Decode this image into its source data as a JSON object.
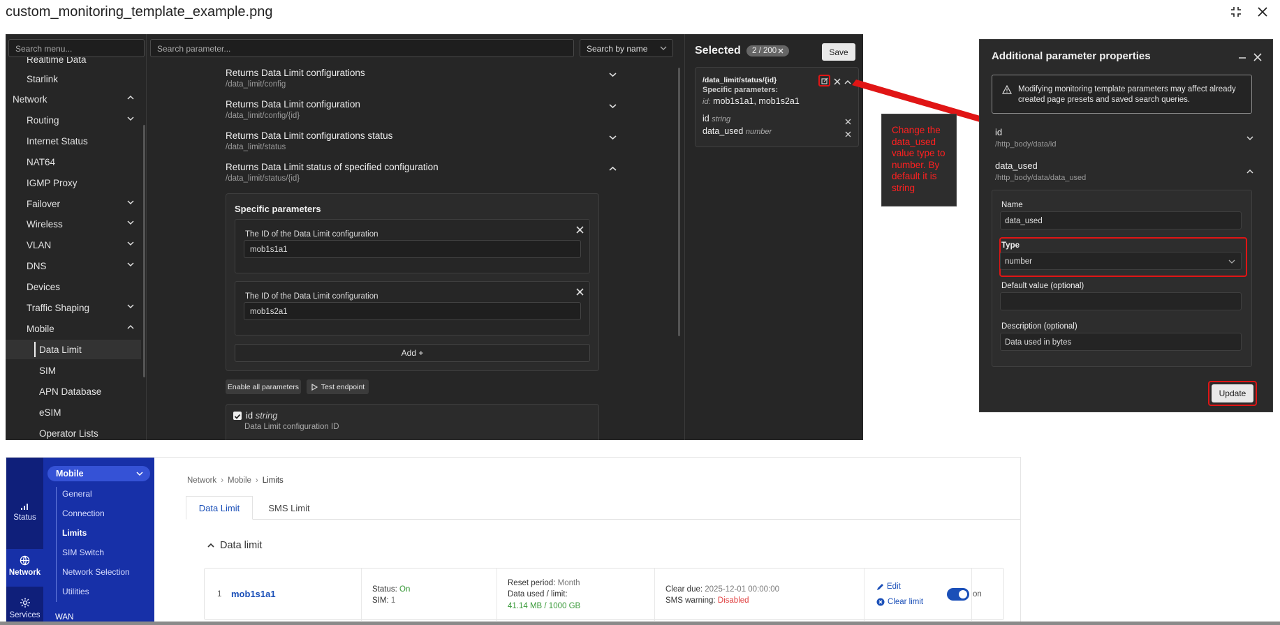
{
  "viewer": {
    "filename": "custom_monitoring_template_example.png"
  },
  "menu": {
    "search_placeholder": "Search menu...",
    "items": [
      {
        "label": "Realtime Data",
        "level": 1,
        "chevron": ""
      },
      {
        "label": "Starlink",
        "level": 1,
        "chevron": ""
      },
      {
        "label": "Network",
        "level": 0,
        "chevron": "up"
      },
      {
        "label": "Routing",
        "level": 1,
        "chevron": "down"
      },
      {
        "label": "Internet Status",
        "level": 1,
        "chevron": ""
      },
      {
        "label": "NAT64",
        "level": 1,
        "chevron": ""
      },
      {
        "label": "IGMP Proxy",
        "level": 1,
        "chevron": ""
      },
      {
        "label": "Failover",
        "level": 1,
        "chevron": "down"
      },
      {
        "label": "Wireless",
        "level": 1,
        "chevron": "down"
      },
      {
        "label": "VLAN",
        "level": 1,
        "chevron": "down"
      },
      {
        "label": "DNS",
        "level": 1,
        "chevron": "down"
      },
      {
        "label": "Devices",
        "level": 1,
        "chevron": ""
      },
      {
        "label": "Traffic Shaping",
        "level": 1,
        "chevron": "down"
      },
      {
        "label": "Mobile",
        "level": 1,
        "chevron": "up"
      },
      {
        "label": "Data Limit",
        "level": 2,
        "chevron": "",
        "active": true
      },
      {
        "label": "SIM",
        "level": 2,
        "chevron": ""
      },
      {
        "label": "APN Database",
        "level": 2,
        "chevron": ""
      },
      {
        "label": "eSIM",
        "level": 2,
        "chevron": ""
      },
      {
        "label": "Operator Lists",
        "level": 2,
        "chevron": ""
      }
    ]
  },
  "params": {
    "search_placeholder": "Search parameter...",
    "search_mode": "Search by name",
    "endpoints": [
      {
        "title": "Returns Data Limit configurations",
        "path": "/data_limit/config",
        "expanded": false
      },
      {
        "title": "Returns Data Limit configuration",
        "path": "/data_limit/config/{id}",
        "expanded": false
      },
      {
        "title": "Returns Data Limit configurations status",
        "path": "/data_limit/status",
        "expanded": false
      },
      {
        "title": "Returns Data Limit status of specified configuration",
        "path": "/data_limit/status/{id}",
        "expanded": true
      }
    ],
    "specific_title": "Specific parameters",
    "specific_items": [
      {
        "label": "The ID of the Data Limit configuration",
        "value": "mob1s1a1"
      },
      {
        "label": "The ID of the Data Limit configuration",
        "value": "mob1s2a1"
      }
    ],
    "add_label": "Add +",
    "enable_all_label": "Enable all parameters",
    "test_label": "Test endpoint",
    "id_param": {
      "name": "id",
      "type": "string",
      "desc": "Data Limit configuration ID"
    }
  },
  "selected": {
    "title": "Selected",
    "count": "2 / 200",
    "save_label": "Save",
    "card": {
      "path": "/data_limit/status/{id}",
      "specific_label": "Specific parameters:",
      "id_prefix": "id:",
      "id_values": "mob1s1a1, mob1s2a1",
      "fields": [
        {
          "name": "id",
          "type": "string"
        },
        {
          "name": "data_used",
          "type": "number"
        }
      ]
    }
  },
  "annotation": {
    "text": "Change the data_used value type to number. By default it is string"
  },
  "properties": {
    "title": "Additional parameter properties",
    "warning": "Modifying monitoring template parameters may affect already created page presets and saved search queries.",
    "params": [
      {
        "name": "id",
        "path": "/http_body/data/id",
        "expanded": false
      },
      {
        "name": "data_used",
        "path": "/http_body/data/data_used",
        "expanded": true
      }
    ],
    "form": {
      "name_label": "Name",
      "name_value": "data_used",
      "type_label": "Type",
      "type_value": "number",
      "default_label": "Default value (optional)",
      "default_value": "",
      "desc_label": "Description (optional)",
      "desc_value": "Data used in bytes"
    },
    "update_label": "Update"
  },
  "router": {
    "rail": [
      {
        "label": "Status",
        "icon": "signal-icon"
      },
      {
        "label": "Network",
        "icon": "globe-icon",
        "active": true
      },
      {
        "label": "Services",
        "icon": "gear-icon"
      }
    ],
    "section_label": "Mobile",
    "submenu": [
      {
        "label": "General"
      },
      {
        "label": "Connection"
      },
      {
        "label": "Limits",
        "active": true
      },
      {
        "label": "SIM Switch"
      },
      {
        "label": "Network Selection"
      },
      {
        "label": "Utilities"
      }
    ],
    "wan_label": "WAN",
    "breadcrumb": [
      "Network",
      "Mobile",
      "Limits"
    ],
    "tabs": [
      {
        "label": "Data Limit",
        "active": true
      },
      {
        "label": "SMS Limit",
        "active": false
      }
    ],
    "section_title": "Data limit",
    "row": {
      "index": "1",
      "name": "mob1s1a1",
      "status_key": "Status:",
      "status_val": "On",
      "sim_key": "SIM:",
      "sim_val": "1",
      "reset_key": "Reset period:",
      "reset_val": "Month",
      "used_key": "Data used / limit:",
      "used_val": "41.14 MB / 1000 GB",
      "clear_key": "Clear due:",
      "clear_val": "2025-12-01 00:00:00",
      "sms_key": "SMS warning:",
      "sms_val": "Disabled",
      "edit_label": "Edit",
      "clear_label": "Clear limit",
      "toggle_label": "on"
    }
  }
}
